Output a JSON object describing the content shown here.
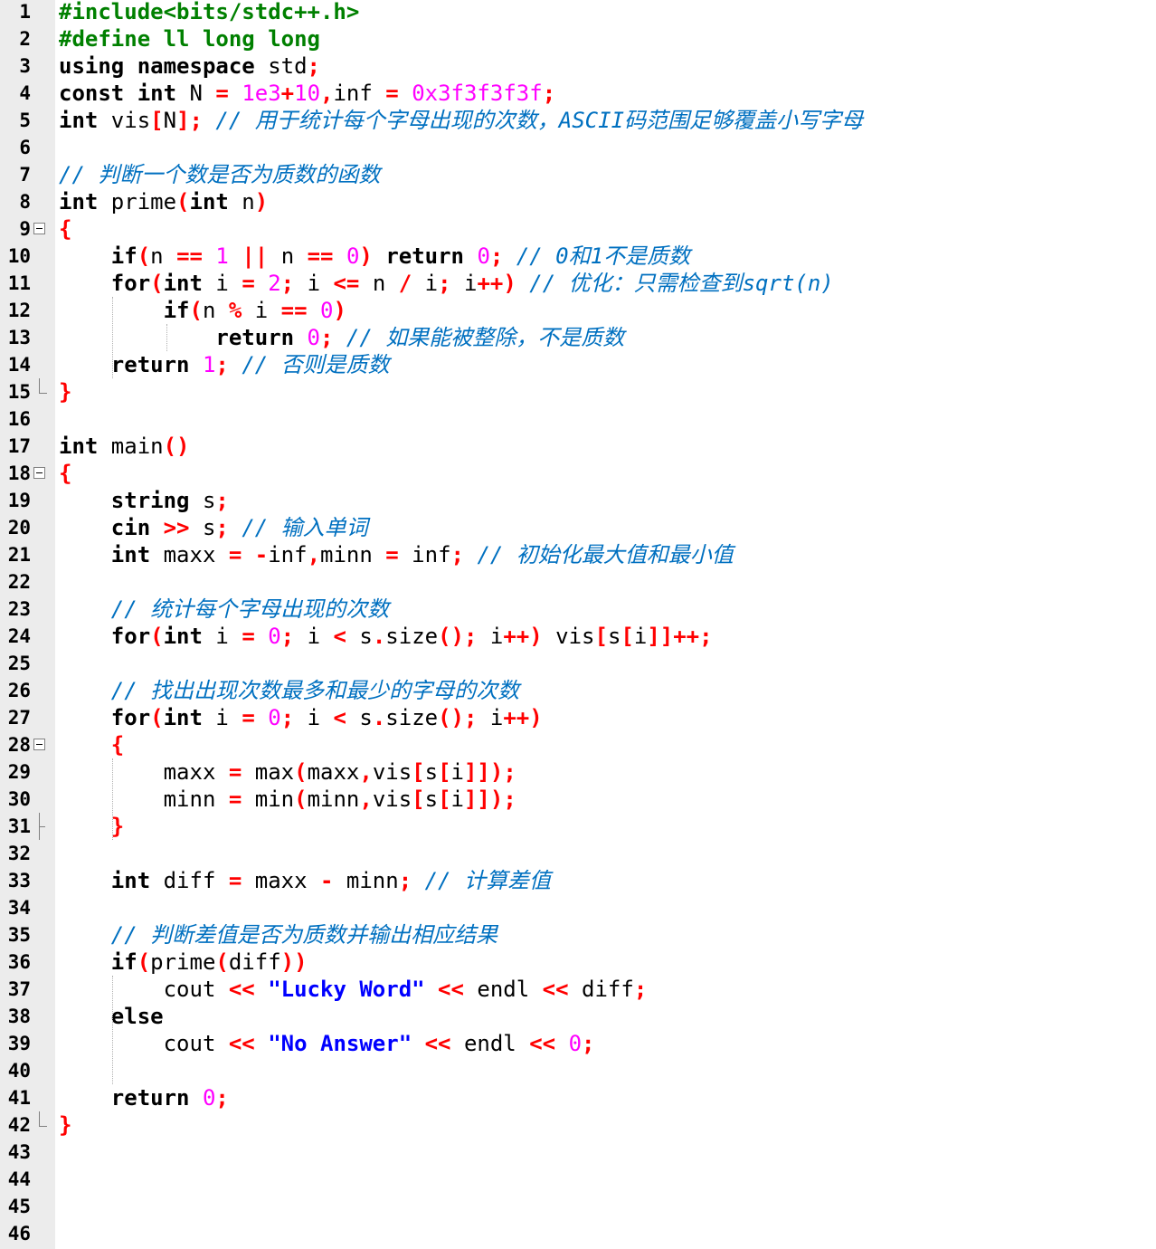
{
  "editor": {
    "colors": {
      "keyword": "#000000",
      "preprocessor": "#008000",
      "number": "#ff00ff",
      "operator": "#ff0000",
      "string": "#0000ff",
      "comment": "#0070c0",
      "gutter": "#ececec"
    },
    "lines": [
      {
        "num": "1",
        "fold": "",
        "tokens": [
          {
            "t": "pp",
            "v": "#include<bits/stdc++.h>"
          }
        ]
      },
      {
        "num": "2",
        "fold": "",
        "tokens": [
          {
            "t": "pp",
            "v": "#define ll long long"
          }
        ]
      },
      {
        "num": "3",
        "fold": "",
        "tokens": [
          {
            "t": "kw",
            "v": "using namespace "
          },
          {
            "t": "id",
            "v": "std"
          },
          {
            "t": "op",
            "v": ";"
          }
        ]
      },
      {
        "num": "4",
        "fold": "",
        "tokens": [
          {
            "t": "kw",
            "v": "const int "
          },
          {
            "t": "id",
            "v": "N "
          },
          {
            "t": "op",
            "v": "= "
          },
          {
            "t": "num",
            "v": "1e3"
          },
          {
            "t": "op",
            "v": "+"
          },
          {
            "t": "num",
            "v": "10"
          },
          {
            "t": "op",
            "v": ","
          },
          {
            "t": "id",
            "v": "inf "
          },
          {
            "t": "op",
            "v": "= "
          },
          {
            "t": "num",
            "v": "0x3f3f3f3f"
          },
          {
            "t": "op",
            "v": ";"
          }
        ]
      },
      {
        "num": "5",
        "fold": "",
        "tokens": [
          {
            "t": "kw",
            "v": "int "
          },
          {
            "t": "id",
            "v": "vis"
          },
          {
            "t": "op",
            "v": "["
          },
          {
            "t": "id",
            "v": "N"
          },
          {
            "t": "op",
            "v": "]; "
          },
          {
            "t": "cm",
            "v": "// 用于统计每个字母出现的次数，ASCII码范围足够覆盖小写字母"
          }
        ]
      },
      {
        "num": "6",
        "fold": "",
        "tokens": []
      },
      {
        "num": "7",
        "fold": "",
        "tokens": [
          {
            "t": "cm",
            "v": "// 判断一个数是否为质数的函数"
          }
        ]
      },
      {
        "num": "8",
        "fold": "",
        "tokens": [
          {
            "t": "kw",
            "v": "int "
          },
          {
            "t": "id",
            "v": "prime"
          },
          {
            "t": "op",
            "v": "("
          },
          {
            "t": "kw",
            "v": "int "
          },
          {
            "t": "id",
            "v": "n"
          },
          {
            "t": "op",
            "v": ")"
          }
        ]
      },
      {
        "num": "9",
        "fold": "open",
        "tokens": [
          {
            "t": "op",
            "v": "{"
          }
        ]
      },
      {
        "num": "10",
        "fold": "",
        "tokens": [
          {
            "t": "id",
            "v": "    "
          },
          {
            "t": "kw",
            "v": "if"
          },
          {
            "t": "op",
            "v": "("
          },
          {
            "t": "id",
            "v": "n "
          },
          {
            "t": "op",
            "v": "== "
          },
          {
            "t": "num",
            "v": "1 "
          },
          {
            "t": "op",
            "v": "|| "
          },
          {
            "t": "id",
            "v": "n "
          },
          {
            "t": "op",
            "v": "== "
          },
          {
            "t": "num",
            "v": "0"
          },
          {
            "t": "op",
            "v": ") "
          },
          {
            "t": "kw",
            "v": "return "
          },
          {
            "t": "num",
            "v": "0"
          },
          {
            "t": "op",
            "v": "; "
          },
          {
            "t": "cm",
            "v": "// 0和1不是质数"
          }
        ]
      },
      {
        "num": "11",
        "fold": "",
        "tokens": [
          {
            "t": "id",
            "v": "    "
          },
          {
            "t": "kw",
            "v": "for"
          },
          {
            "t": "op",
            "v": "("
          },
          {
            "t": "kw",
            "v": "int "
          },
          {
            "t": "id",
            "v": "i "
          },
          {
            "t": "op",
            "v": "= "
          },
          {
            "t": "num",
            "v": "2"
          },
          {
            "t": "op",
            "v": "; "
          },
          {
            "t": "id",
            "v": "i "
          },
          {
            "t": "op",
            "v": "<= "
          },
          {
            "t": "id",
            "v": "n "
          },
          {
            "t": "op",
            "v": "/ "
          },
          {
            "t": "id",
            "v": "i"
          },
          {
            "t": "op",
            "v": "; "
          },
          {
            "t": "id",
            "v": "i"
          },
          {
            "t": "op",
            "v": "++) "
          },
          {
            "t": "cm",
            "v": "// 优化：只需检查到sqrt(n)"
          }
        ]
      },
      {
        "num": "12",
        "fold": "",
        "tokens": [
          {
            "t": "id",
            "v": "        "
          },
          {
            "t": "kw",
            "v": "if"
          },
          {
            "t": "op",
            "v": "("
          },
          {
            "t": "id",
            "v": "n "
          },
          {
            "t": "op",
            "v": "% "
          },
          {
            "t": "id",
            "v": "i "
          },
          {
            "t": "op",
            "v": "== "
          },
          {
            "t": "num",
            "v": "0"
          },
          {
            "t": "op",
            "v": ")"
          }
        ]
      },
      {
        "num": "13",
        "fold": "",
        "tokens": [
          {
            "t": "id",
            "v": "            "
          },
          {
            "t": "kw",
            "v": "return "
          },
          {
            "t": "num",
            "v": "0"
          },
          {
            "t": "op",
            "v": "; "
          },
          {
            "t": "cm",
            "v": "// 如果能被整除，不是质数"
          }
        ]
      },
      {
        "num": "14",
        "fold": "",
        "tokens": [
          {
            "t": "id",
            "v": "    "
          },
          {
            "t": "kw",
            "v": "return "
          },
          {
            "t": "num",
            "v": "1"
          },
          {
            "t": "op",
            "v": "; "
          },
          {
            "t": "cm",
            "v": "// 否则是质数"
          }
        ]
      },
      {
        "num": "15",
        "fold": "end",
        "tokens": [
          {
            "t": "op",
            "v": "}"
          }
        ]
      },
      {
        "num": "16",
        "fold": "",
        "tokens": []
      },
      {
        "num": "17",
        "fold": "",
        "tokens": [
          {
            "t": "kw",
            "v": "int "
          },
          {
            "t": "id",
            "v": "main"
          },
          {
            "t": "op",
            "v": "()"
          }
        ]
      },
      {
        "num": "18",
        "fold": "open",
        "tokens": [
          {
            "t": "op",
            "v": "{"
          }
        ]
      },
      {
        "num": "19",
        "fold": "",
        "tokens": [
          {
            "t": "id",
            "v": "    "
          },
          {
            "t": "kw",
            "v": "string "
          },
          {
            "t": "id",
            "v": "s"
          },
          {
            "t": "op",
            "v": ";"
          }
        ]
      },
      {
        "num": "20",
        "fold": "",
        "tokens": [
          {
            "t": "id",
            "v": "    "
          },
          {
            "t": "kw",
            "v": "cin "
          },
          {
            "t": "op",
            "v": ">> "
          },
          {
            "t": "id",
            "v": "s"
          },
          {
            "t": "op",
            "v": "; "
          },
          {
            "t": "cm",
            "v": "// 输入单词"
          }
        ]
      },
      {
        "num": "21",
        "fold": "",
        "tokens": [
          {
            "t": "id",
            "v": "    "
          },
          {
            "t": "kw",
            "v": "int "
          },
          {
            "t": "id",
            "v": "maxx "
          },
          {
            "t": "op",
            "v": "= -"
          },
          {
            "t": "id",
            "v": "inf"
          },
          {
            "t": "op",
            "v": ","
          },
          {
            "t": "id",
            "v": "minn "
          },
          {
            "t": "op",
            "v": "= "
          },
          {
            "t": "id",
            "v": "inf"
          },
          {
            "t": "op",
            "v": "; "
          },
          {
            "t": "cm",
            "v": "// 初始化最大值和最小值"
          }
        ]
      },
      {
        "num": "22",
        "fold": "",
        "tokens": []
      },
      {
        "num": "23",
        "fold": "",
        "tokens": [
          {
            "t": "id",
            "v": "    "
          },
          {
            "t": "cm",
            "v": "// 统计每个字母出现的次数"
          }
        ]
      },
      {
        "num": "24",
        "fold": "",
        "tokens": [
          {
            "t": "id",
            "v": "    "
          },
          {
            "t": "kw",
            "v": "for"
          },
          {
            "t": "op",
            "v": "("
          },
          {
            "t": "kw",
            "v": "int "
          },
          {
            "t": "id",
            "v": "i "
          },
          {
            "t": "op",
            "v": "= "
          },
          {
            "t": "num",
            "v": "0"
          },
          {
            "t": "op",
            "v": "; "
          },
          {
            "t": "id",
            "v": "i "
          },
          {
            "t": "op",
            "v": "< "
          },
          {
            "t": "id",
            "v": "s"
          },
          {
            "t": "op",
            "v": "."
          },
          {
            "t": "id",
            "v": "size"
          },
          {
            "t": "op",
            "v": "(); "
          },
          {
            "t": "id",
            "v": "i"
          },
          {
            "t": "op",
            "v": "++) "
          },
          {
            "t": "id",
            "v": "vis"
          },
          {
            "t": "op",
            "v": "["
          },
          {
            "t": "id",
            "v": "s"
          },
          {
            "t": "op",
            "v": "["
          },
          {
            "t": "id",
            "v": "i"
          },
          {
            "t": "op",
            "v": "]]++;"
          }
        ]
      },
      {
        "num": "25",
        "fold": "",
        "tokens": []
      },
      {
        "num": "26",
        "fold": "",
        "tokens": [
          {
            "t": "id",
            "v": "    "
          },
          {
            "t": "cm",
            "v": "// 找出出现次数最多和最少的字母的次数"
          }
        ]
      },
      {
        "num": "27",
        "fold": "",
        "tokens": [
          {
            "t": "id",
            "v": "    "
          },
          {
            "t": "kw",
            "v": "for"
          },
          {
            "t": "op",
            "v": "("
          },
          {
            "t": "kw",
            "v": "int "
          },
          {
            "t": "id",
            "v": "i "
          },
          {
            "t": "op",
            "v": "= "
          },
          {
            "t": "num",
            "v": "0"
          },
          {
            "t": "op",
            "v": "; "
          },
          {
            "t": "id",
            "v": "i "
          },
          {
            "t": "op",
            "v": "< "
          },
          {
            "t": "id",
            "v": "s"
          },
          {
            "t": "op",
            "v": "."
          },
          {
            "t": "id",
            "v": "size"
          },
          {
            "t": "op",
            "v": "(); "
          },
          {
            "t": "id",
            "v": "i"
          },
          {
            "t": "op",
            "v": "++)"
          }
        ]
      },
      {
        "num": "28",
        "fold": "open",
        "tokens": [
          {
            "t": "id",
            "v": "    "
          },
          {
            "t": "op",
            "v": "{"
          }
        ]
      },
      {
        "num": "29",
        "fold": "",
        "tokens": [
          {
            "t": "id",
            "v": "        maxx "
          },
          {
            "t": "op",
            "v": "= "
          },
          {
            "t": "id",
            "v": "max"
          },
          {
            "t": "op",
            "v": "("
          },
          {
            "t": "id",
            "v": "maxx"
          },
          {
            "t": "op",
            "v": ","
          },
          {
            "t": "id",
            "v": "vis"
          },
          {
            "t": "op",
            "v": "["
          },
          {
            "t": "id",
            "v": "s"
          },
          {
            "t": "op",
            "v": "["
          },
          {
            "t": "id",
            "v": "i"
          },
          {
            "t": "op",
            "v": "]]);"
          }
        ]
      },
      {
        "num": "30",
        "fold": "",
        "tokens": [
          {
            "t": "id",
            "v": "        minn "
          },
          {
            "t": "op",
            "v": "= "
          },
          {
            "t": "id",
            "v": "min"
          },
          {
            "t": "op",
            "v": "("
          },
          {
            "t": "id",
            "v": "minn"
          },
          {
            "t": "op",
            "v": ","
          },
          {
            "t": "id",
            "v": "vis"
          },
          {
            "t": "op",
            "v": "["
          },
          {
            "t": "id",
            "v": "s"
          },
          {
            "t": "op",
            "v": "["
          },
          {
            "t": "id",
            "v": "i"
          },
          {
            "t": "op",
            "v": "]]);"
          }
        ]
      },
      {
        "num": "31",
        "fold": "tee",
        "tokens": [
          {
            "t": "id",
            "v": "    "
          },
          {
            "t": "op",
            "v": "}"
          }
        ]
      },
      {
        "num": "32",
        "fold": "",
        "tokens": []
      },
      {
        "num": "33",
        "fold": "",
        "tokens": [
          {
            "t": "id",
            "v": "    "
          },
          {
            "t": "kw",
            "v": "int "
          },
          {
            "t": "id",
            "v": "diff "
          },
          {
            "t": "op",
            "v": "= "
          },
          {
            "t": "id",
            "v": "maxx "
          },
          {
            "t": "op",
            "v": "- "
          },
          {
            "t": "id",
            "v": "minn"
          },
          {
            "t": "op",
            "v": "; "
          },
          {
            "t": "cm",
            "v": "// 计算差值"
          }
        ]
      },
      {
        "num": "34",
        "fold": "",
        "tokens": []
      },
      {
        "num": "35",
        "fold": "",
        "tokens": [
          {
            "t": "id",
            "v": "    "
          },
          {
            "t": "cm",
            "v": "// 判断差值是否为质数并输出相应结果"
          }
        ]
      },
      {
        "num": "36",
        "fold": "",
        "tokens": [
          {
            "t": "id",
            "v": "    "
          },
          {
            "t": "kw",
            "v": "if"
          },
          {
            "t": "op",
            "v": "("
          },
          {
            "t": "id",
            "v": "prime"
          },
          {
            "t": "op",
            "v": "("
          },
          {
            "t": "id",
            "v": "diff"
          },
          {
            "t": "op",
            "v": "))"
          }
        ]
      },
      {
        "num": "37",
        "fold": "",
        "tokens": [
          {
            "t": "id",
            "v": "        cout "
          },
          {
            "t": "op",
            "v": "<< "
          },
          {
            "t": "str",
            "v": "\"Lucky Word\" "
          },
          {
            "t": "op",
            "v": "<< "
          },
          {
            "t": "id",
            "v": "endl "
          },
          {
            "t": "op",
            "v": "<< "
          },
          {
            "t": "id",
            "v": "diff"
          },
          {
            "t": "op",
            "v": ";"
          }
        ]
      },
      {
        "num": "38",
        "fold": "",
        "tokens": [
          {
            "t": "id",
            "v": "    "
          },
          {
            "t": "kw",
            "v": "else"
          }
        ]
      },
      {
        "num": "39",
        "fold": "",
        "tokens": [
          {
            "t": "id",
            "v": "        cout "
          },
          {
            "t": "op",
            "v": "<< "
          },
          {
            "t": "str",
            "v": "\"No Answer\" "
          },
          {
            "t": "op",
            "v": "<< "
          },
          {
            "t": "id",
            "v": "endl "
          },
          {
            "t": "op",
            "v": "<< "
          },
          {
            "t": "num",
            "v": "0"
          },
          {
            "t": "op",
            "v": ";"
          }
        ]
      },
      {
        "num": "40",
        "fold": "",
        "tokens": []
      },
      {
        "num": "41",
        "fold": "",
        "tokens": [
          {
            "t": "id",
            "v": "    "
          },
          {
            "t": "kw",
            "v": "return "
          },
          {
            "t": "num",
            "v": "0"
          },
          {
            "t": "op",
            "v": ";"
          }
        ]
      },
      {
        "num": "42",
        "fold": "end",
        "tokens": [
          {
            "t": "op",
            "v": "}"
          }
        ]
      },
      {
        "num": "43",
        "fold": "",
        "tokens": []
      },
      {
        "num": "44",
        "fold": "",
        "tokens": []
      },
      {
        "num": "45",
        "fold": "",
        "tokens": []
      },
      {
        "num": "46",
        "fold": "",
        "tokens": []
      }
    ]
  }
}
